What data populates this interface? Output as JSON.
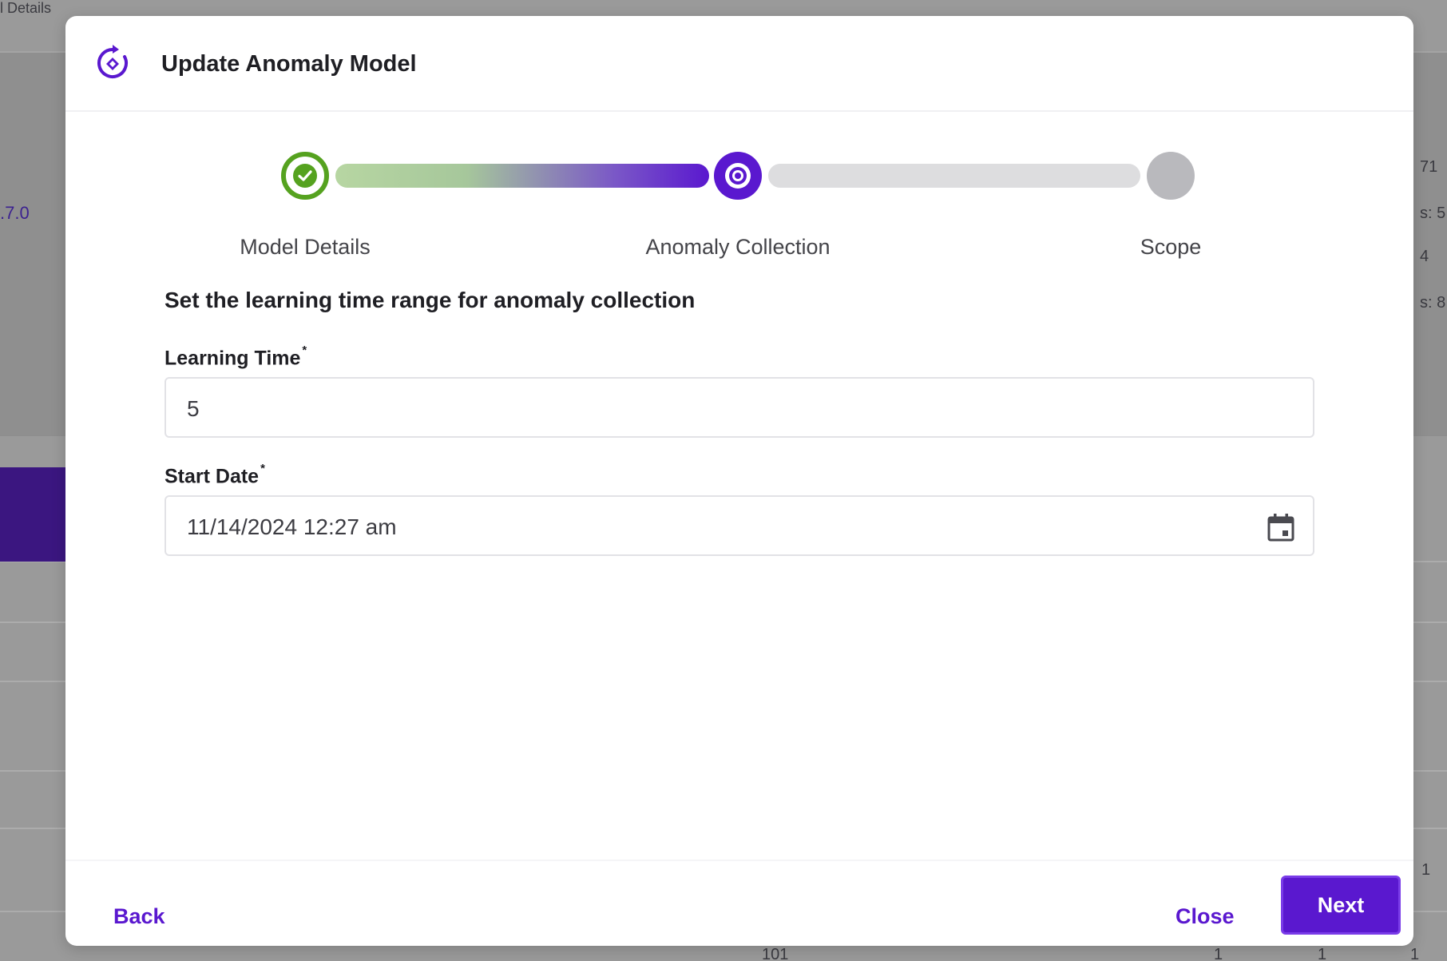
{
  "background": {
    "breadcrumb_fragment": "l Details",
    "version_fragment": ".7.0",
    "right_fragments": [
      "71",
      "s: 5",
      "4",
      "s: 8"
    ],
    "footer_fragments": [
      "101",
      "1",
      "1",
      "1",
      "1"
    ]
  },
  "modal": {
    "icon": "anomaly-model-icon",
    "title": "Update Anomaly Model",
    "stepper": {
      "steps": [
        {
          "label": "Model Details",
          "status": "complete"
        },
        {
          "label": "Anomaly Collection",
          "status": "active"
        },
        {
          "label": "Scope",
          "status": "pending"
        }
      ]
    },
    "section_heading": "Set the learning time range for anomaly collection",
    "fields": {
      "learning_time": {
        "label": "Learning Time",
        "required_mark": "*",
        "value": "5"
      },
      "start_date": {
        "label": "Start Date",
        "required_mark": "*",
        "value": "11/14/2024 12:27 am",
        "icon": "calendar-icon"
      }
    },
    "footer": {
      "back_label": "Back",
      "close_label": "Close",
      "next_label": "Next"
    }
  },
  "colors": {
    "accent": "#5a18cf",
    "success": "#55a21f",
    "pending": "#b9b9bd"
  }
}
